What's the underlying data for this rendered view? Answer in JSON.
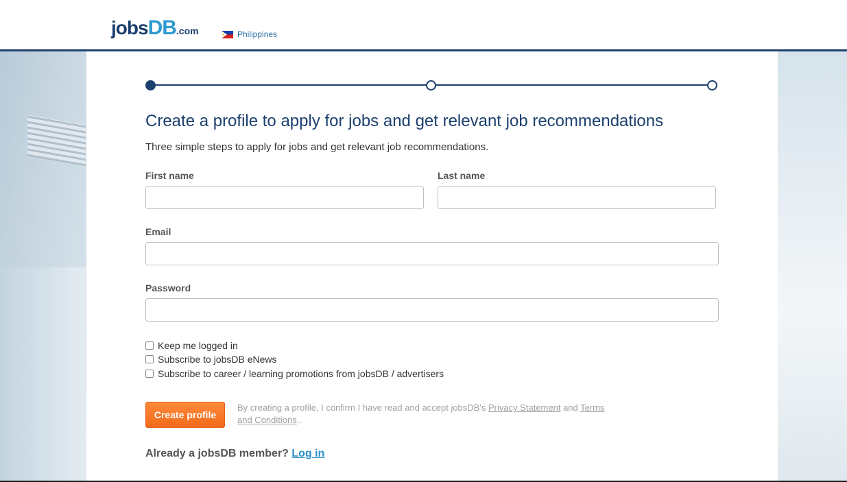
{
  "header": {
    "logo": {
      "jobs": "jobs",
      "db": "DB",
      "com": ".com"
    },
    "country": "Philippines"
  },
  "progress": {
    "total_steps": 3,
    "current_step": 1
  },
  "form": {
    "title": "Create a profile to apply for jobs and get relevant job recommendations",
    "subtitle": "Three simple steps to apply for jobs and get relevant job recommendations.",
    "first_name_label": "First name",
    "last_name_label": "Last name",
    "email_label": "Email",
    "password_label": "Password",
    "first_name_value": "",
    "last_name_value": "",
    "email_value": "",
    "password_value": "",
    "checkboxes": [
      {
        "label": "Keep me logged in",
        "checked": false
      },
      {
        "label": "Subscribe to jobsDB eNews",
        "checked": false
      },
      {
        "label": "Subscribe to career / learning promotions from jobsDB / advertisers",
        "checked": false
      }
    ],
    "submit_label": "Create profile",
    "terms_prefix": "By creating a profile, I confirm I have read and accept jobsDB's ",
    "privacy_link": "Privacy Statement",
    "terms_and": " and ",
    "terms_link": "Terms and Conditions",
    "terms_suffix": "..",
    "member_text": "Already a jobsDB member? ",
    "login_link": "Log in"
  },
  "colors": {
    "brand_navy": "#1c3f6e",
    "brand_blue": "#2e9ad0",
    "button_orange": "#f26a1b"
  }
}
